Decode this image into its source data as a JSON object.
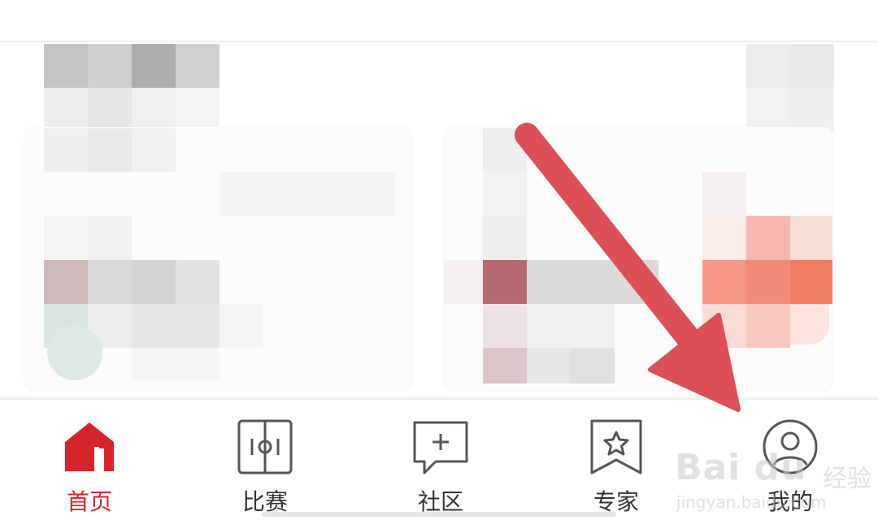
{
  "tabbar": {
    "active_color": "#d6242b",
    "inactive_color": "#555555",
    "tabs": [
      {
        "label": "首页",
        "icon": "home-icon",
        "active": true
      },
      {
        "label": "比赛",
        "icon": "match-field-icon",
        "active": false
      },
      {
        "label": "社区",
        "icon": "community-chat-icon",
        "active": false
      },
      {
        "label": "专家",
        "icon": "expert-star-icon",
        "active": false
      },
      {
        "label": "我的",
        "icon": "profile-icon",
        "active": false
      }
    ]
  },
  "annotation": {
    "arrow_icon": "red-arrow-pointer",
    "arrow_color": "#dc4f57"
  },
  "watermark": {
    "brand": "Bai du",
    "brand_cn": "经验",
    "url": "jingyan.baidu.com"
  }
}
